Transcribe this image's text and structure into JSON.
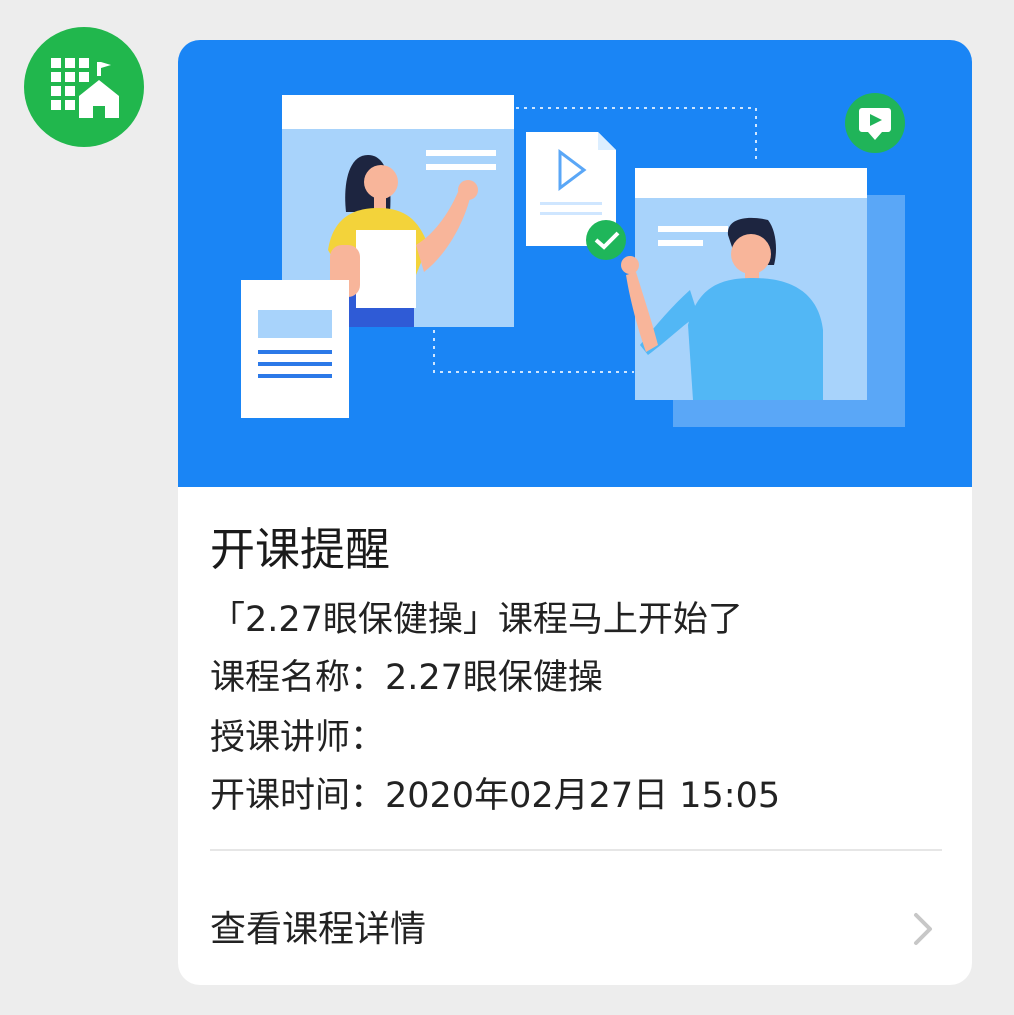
{
  "message": {
    "sender_avatar_icon": "building-school-icon",
    "card": {
      "banner_image": "online-class-illustration",
      "title": "开课提醒",
      "subtitle": "「2.27眼保健操」课程马上开始了",
      "course_name": "课程名称：2.27眼保健操",
      "instructor": "授课讲师：",
      "start_time": "开课时间：2020年02月27日 15:05",
      "action_label": "查看课程详情",
      "action_icon": "chevron-right-icon"
    }
  },
  "colors": {
    "background": "#ededed",
    "avatar": "#21b74d",
    "banner": "#1a85f5",
    "card": "#ffffff"
  }
}
